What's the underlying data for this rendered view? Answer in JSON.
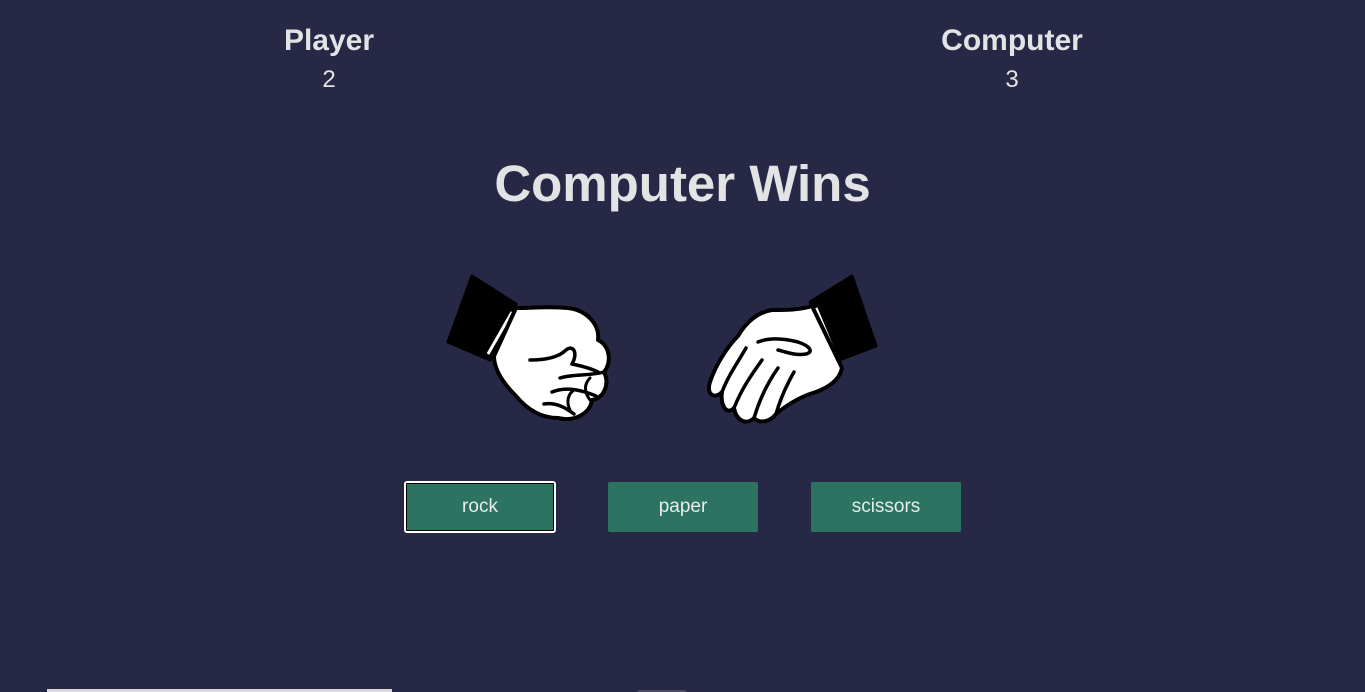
{
  "scoreboard": {
    "player": {
      "label": "Player",
      "score": "2"
    },
    "computer": {
      "label": "Computer",
      "score": "3"
    }
  },
  "result": "Computer Wins",
  "hands": {
    "player": {
      "choice": "rock",
      "icon": "fist-icon"
    },
    "computer": {
      "choice": "paper",
      "icon": "open-hand-icon"
    }
  },
  "buttons": {
    "rock": "rock",
    "paper": "paper",
    "scissors": "scissors"
  },
  "colors": {
    "background": "#272845",
    "button": "#2c7361",
    "text": "#e3e3e6"
  }
}
